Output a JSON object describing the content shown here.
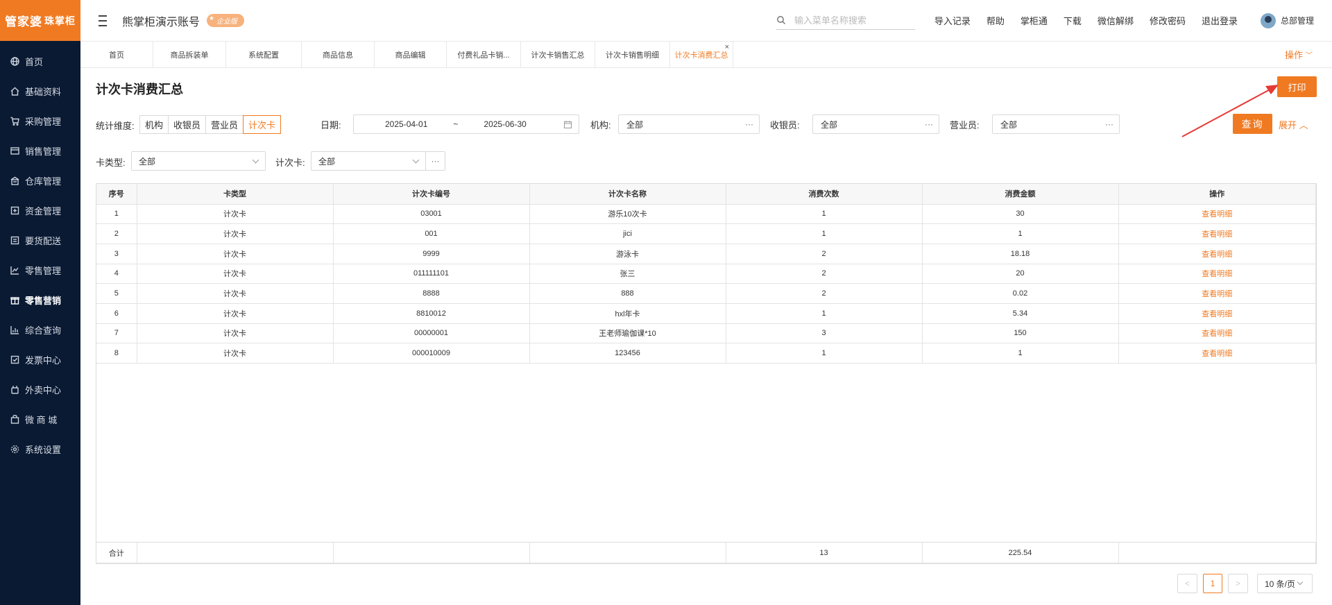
{
  "logo": {
    "main": "管家婆",
    "sub": "珠掌柜"
  },
  "sidebar": {
    "items": [
      {
        "label": "首页",
        "icon": "globe-icon"
      },
      {
        "label": "基础资料",
        "icon": "home-icon"
      },
      {
        "label": "采购管理",
        "icon": "cart-icon"
      },
      {
        "label": "销售管理",
        "icon": "sales-icon"
      },
      {
        "label": "仓库管理",
        "icon": "warehouse-icon"
      },
      {
        "label": "资金管理",
        "icon": "money-icon"
      },
      {
        "label": "要货配送",
        "icon": "delivery-icon"
      },
      {
        "label": "零售管理",
        "icon": "chart-icon"
      },
      {
        "label": "零售营销",
        "icon": "gift-icon"
      },
      {
        "label": "综合查询",
        "icon": "bar-chart-icon"
      },
      {
        "label": "发票中心",
        "icon": "invoice-icon"
      },
      {
        "label": "外卖中心",
        "icon": "takeout-icon"
      },
      {
        "label": "微 商 城",
        "icon": "shop-icon"
      },
      {
        "label": "系统设置",
        "icon": "gear-icon"
      }
    ],
    "active_index": 8
  },
  "header": {
    "account": "熊掌柜演示账号",
    "edition": "企业版",
    "search_placeholder": "输入菜单名称搜索",
    "links": [
      "导入记录",
      "帮助",
      "掌柜通",
      "下载",
      "微信解绑",
      "修改密码",
      "退出登录"
    ],
    "user": "总部管理"
  },
  "tabs": {
    "items": [
      "首页",
      "商品拆装单",
      "系统配置",
      "商品信息",
      "商品编辑",
      "付费礼品卡销...",
      "计次卡销售汇总",
      "计次卡销售明细",
      "计次卡消费汇总"
    ],
    "active_index": 8,
    "close": "×",
    "operate": "操作"
  },
  "page": {
    "title": "计次卡消费汇总",
    "print": "打印"
  },
  "filters": {
    "dimension_label": "统计维度:",
    "dimensions": [
      "机构",
      "收银员",
      "营业员",
      "计次卡"
    ],
    "dimension_active": 3,
    "date_label": "日期:",
    "date_from": "2025-04-01",
    "date_sep": "~",
    "date_to": "2025-06-30",
    "org_label": "机构:",
    "org_value": "全部",
    "cashier_label": "收银员:",
    "cashier_value": "全部",
    "sales_label": "营业员:",
    "sales_value": "全部",
    "card_type_label": "卡类型:",
    "card_type_value": "全部",
    "card_label": "计次卡:",
    "card_value": "全部",
    "query": "查询",
    "expand": "展开"
  },
  "table": {
    "headers": [
      "序号",
      "卡类型",
      "计次卡编号",
      "计次卡名称",
      "消费次数",
      "消费金额",
      "操作"
    ],
    "rows": [
      [
        "1",
        "计次卡",
        "03001",
        "游乐10次卡",
        "1",
        "30",
        "查看明细"
      ],
      [
        "2",
        "计次卡",
        "001",
        "jici",
        "1",
        "1",
        "查看明细"
      ],
      [
        "3",
        "计次卡",
        "9999",
        "游泳卡",
        "2",
        "18.18",
        "查看明细"
      ],
      [
        "4",
        "计次卡",
        "011111101",
        "张三",
        "2",
        "20",
        "查看明细"
      ],
      [
        "5",
        "计次卡",
        "8888",
        "888",
        "2",
        "0.02",
        "查看明细"
      ],
      [
        "6",
        "计次卡",
        "8810012",
        "hxl年卡",
        "1",
        "5.34",
        "查看明细"
      ],
      [
        "7",
        "计次卡",
        "00000001",
        "王老师瑜伽课*10",
        "3",
        "150",
        "查看明细"
      ],
      [
        "8",
        "计次卡",
        "000010009",
        "123456",
        "1",
        "1",
        "查看明细"
      ]
    ],
    "footer": [
      "合计",
      "",
      "",
      "",
      "13",
      "225.54",
      ""
    ]
  },
  "pagination": {
    "prev": "<",
    "current": "1",
    "next": ">",
    "page_size": "10 条/页"
  },
  "colors": {
    "accent": "#f07a22",
    "sidebar_bg": "#0a1a33",
    "annotation_arrow": "#e53935"
  }
}
